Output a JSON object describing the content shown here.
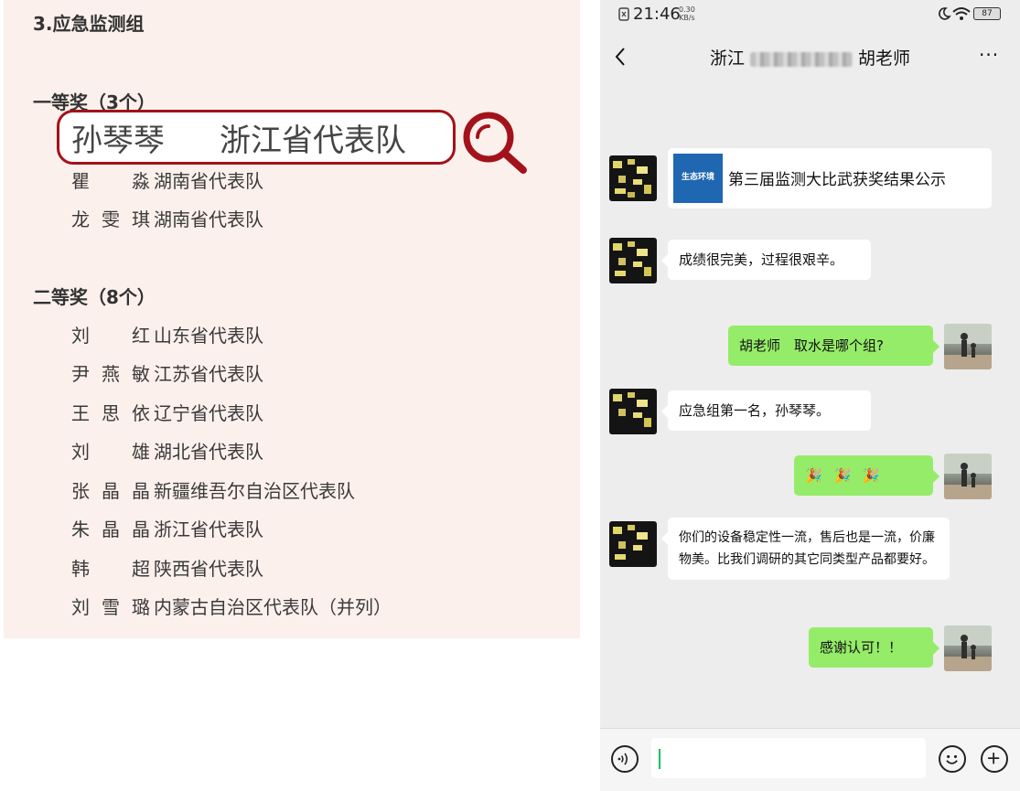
{
  "document": {
    "section_title": "3.应急监测组",
    "first_prize": {
      "heading": "一等奖（3个）",
      "highlight": {
        "name": "孙琴琴",
        "team": "浙江省代表队"
      },
      "rows": [
        {
          "name": "瞿　淼",
          "team": "湖南省代表队"
        },
        {
          "name": "龙雯琪",
          "team": "湖南省代表队"
        }
      ]
    },
    "second_prize": {
      "heading": "二等奖（8个）",
      "rows": [
        {
          "name": "刘　红",
          "team": "山东省代表队"
        },
        {
          "name": "尹燕敏",
          "team": "江苏省代表队"
        },
        {
          "name": "王思依",
          "team": "辽宁省代表队"
        },
        {
          "name": "刘　雄",
          "team": "湖北省代表队"
        },
        {
          "name": "张晶晶",
          "team": "新疆维吾尔自治区代表队"
        },
        {
          "name": "朱晶晶",
          "team": "浙江省代表队"
        },
        {
          "name": "韩　超",
          "team": "陕西省代表队"
        },
        {
          "name": "刘雪璐",
          "team": "内蒙古自治区代表队（并列）"
        }
      ]
    },
    "magnifier_icon": "magnifier-icon",
    "highlight_color": "#a3121a",
    "background_color": "#fcf0ec"
  },
  "phone": {
    "status_bar": {
      "time": "21:46",
      "rate_top": "0.30",
      "rate_bottom": "KB/s",
      "battery": "87"
    },
    "chat": {
      "title_prefix": "浙江",
      "title_suffix": "胡老师",
      "more": "···"
    },
    "messages": [
      {
        "side": "left",
        "type": "card",
        "thumb_text": "生态环境",
        "title": "第三届监测大比武获奖结果公示"
      },
      {
        "side": "left",
        "type": "text",
        "text": "成绩很完美，过程很艰辛。"
      },
      {
        "side": "right",
        "type": "text",
        "text": "胡老师　取水是哪个组?"
      },
      {
        "side": "left",
        "type": "text",
        "text": "应急组第一名，孙琴琴。"
      },
      {
        "side": "right",
        "type": "text",
        "text": "🎉 🎉 🎉"
      },
      {
        "side": "left",
        "type": "text",
        "text": "你们的设备稳定性一流，售后也是一流，价廉物美。比我们调研的其它同类型产品都要好。"
      },
      {
        "side": "right",
        "type": "text",
        "text": "感谢认可！！"
      }
    ],
    "colors": {
      "own_bubble": "#95ec69",
      "other_bubble": "#ffffff",
      "chat_bg": "#ededed"
    }
  }
}
